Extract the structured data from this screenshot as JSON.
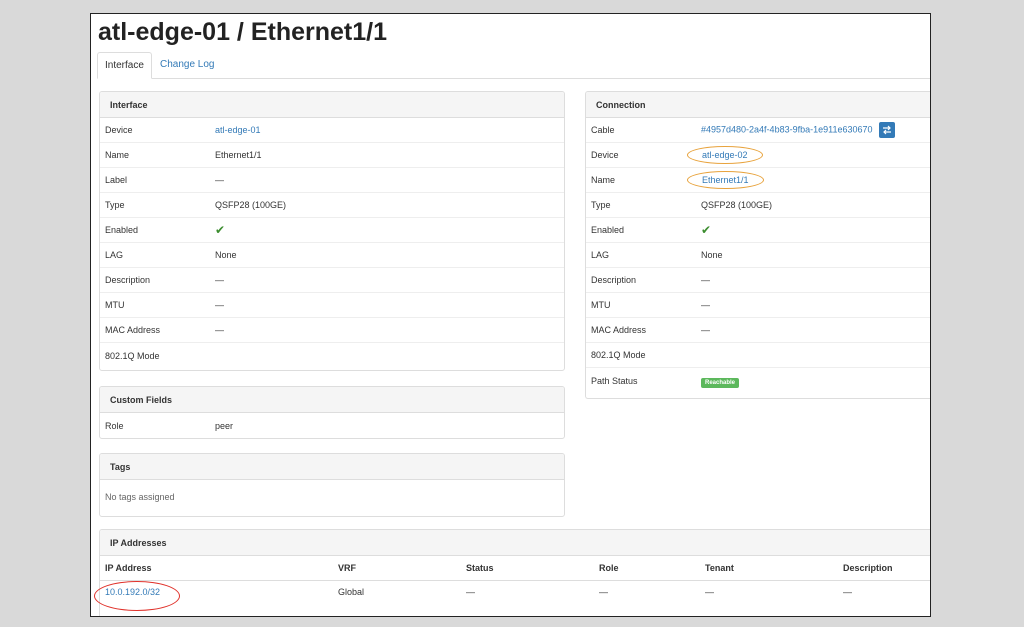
{
  "page": {
    "title": "atl-edge-01 / Ethernet1/1",
    "tabs": [
      {
        "label": "Interface"
      },
      {
        "label": "Change Log"
      }
    ]
  },
  "interface_panel": {
    "heading": "Interface",
    "rows": [
      {
        "key": "Device",
        "value": "atl-edge-01"
      },
      {
        "key": "Name",
        "value": "Ethernet1/1"
      },
      {
        "key": "Label",
        "value": "—"
      },
      {
        "key": "Type",
        "value": "QSFP28 (100GE)"
      },
      {
        "key": "Enabled",
        "value": "✔"
      },
      {
        "key": "LAG",
        "value": "None"
      },
      {
        "key": "Description",
        "value": "—"
      },
      {
        "key": "MTU",
        "value": "—"
      },
      {
        "key": "MAC Address",
        "value": "—"
      },
      {
        "key": "802.1Q Mode",
        "value": ""
      }
    ]
  },
  "custom_fields": {
    "heading": "Custom Fields",
    "rows": [
      {
        "key": "Role",
        "value": "peer"
      }
    ]
  },
  "tags": {
    "heading": "Tags",
    "empty_text": "No tags assigned"
  },
  "connection_panel": {
    "heading": "Connection",
    "rows": [
      {
        "key": "Cable",
        "value": "#4957d480-2a4f-4b83-9fba-1e911e630670"
      },
      {
        "key": "Device",
        "value": "atl-edge-02"
      },
      {
        "key": "Name",
        "value": "Ethernet1/1"
      },
      {
        "key": "Type",
        "value": "QSFP28 (100GE)"
      },
      {
        "key": "Enabled",
        "value": "✔"
      },
      {
        "key": "LAG",
        "value": "None"
      },
      {
        "key": "Description",
        "value": "—"
      },
      {
        "key": "MTU",
        "value": "—"
      },
      {
        "key": "MAC Address",
        "value": "—"
      },
      {
        "key": "802.1Q Mode",
        "value": ""
      },
      {
        "key": "Path Status",
        "value": "Reachable"
      }
    ]
  },
  "ip_addresses": {
    "heading": "IP Addresses",
    "columns": [
      "IP Address",
      "VRF",
      "Status",
      "Role",
      "Tenant",
      "Description"
    ],
    "rows": [
      {
        "ip": "10.0.192.0/32",
        "vrf": "Global",
        "status": "—",
        "role": "—",
        "tenant": "—",
        "description": "—"
      }
    ]
  },
  "colors": {
    "link": "#337ab7",
    "success": "#5cb85c",
    "annotation_orange": "#e8a33d",
    "annotation_red": "#e0322b"
  },
  "icons": {
    "enabled": "check-icon",
    "cable_trace": "swap-icon"
  }
}
